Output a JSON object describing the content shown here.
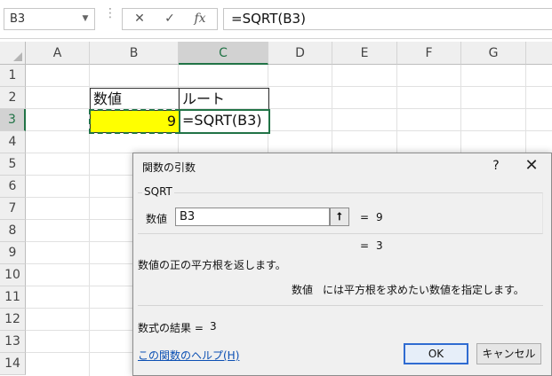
{
  "formula_bar": {
    "name_box": "B3",
    "dropdown_icon": "▼",
    "dots": "⋮",
    "cancel_icon": "✕",
    "enter_icon": "✓",
    "fx_icon": "fx",
    "formula": "=SQRT(B3)"
  },
  "columns": [
    "A",
    "B",
    "C",
    "D",
    "E",
    "F",
    "G"
  ],
  "rows": [
    "1",
    "2",
    "3",
    "4",
    "5",
    "6",
    "7",
    "8",
    "9",
    "10",
    "11",
    "12",
    "13",
    "14"
  ],
  "cells": {
    "B2": "数値",
    "C2": "ルート",
    "B3": "9",
    "C3": "=SQRT(B3)"
  },
  "colors": {
    "highlight": "#ffff00",
    "excel_green": "#217346",
    "link": "#0b4fb3",
    "ok_border": "#2f6bd1"
  },
  "dialog": {
    "title": "関数の引数",
    "help_icon": "?",
    "close_icon": "✕",
    "function_name": "SQRT",
    "arg_label": "数値",
    "arg_value": "B3",
    "ref_button_icon": "⭡",
    "arg_eq": "=",
    "arg_result": "9",
    "result_eq": "=",
    "result_value": "3",
    "description": "数値の正の平方根を返します。",
    "arg_desc_name": "数値",
    "arg_desc_text": "には平方根を求めたい数値を指定します。",
    "formula_result_label": "数式の結果 =",
    "formula_result_value": "3",
    "help_link": "この関数のヘルプ(H)",
    "ok": "OK",
    "cancel": "キャンセル"
  }
}
